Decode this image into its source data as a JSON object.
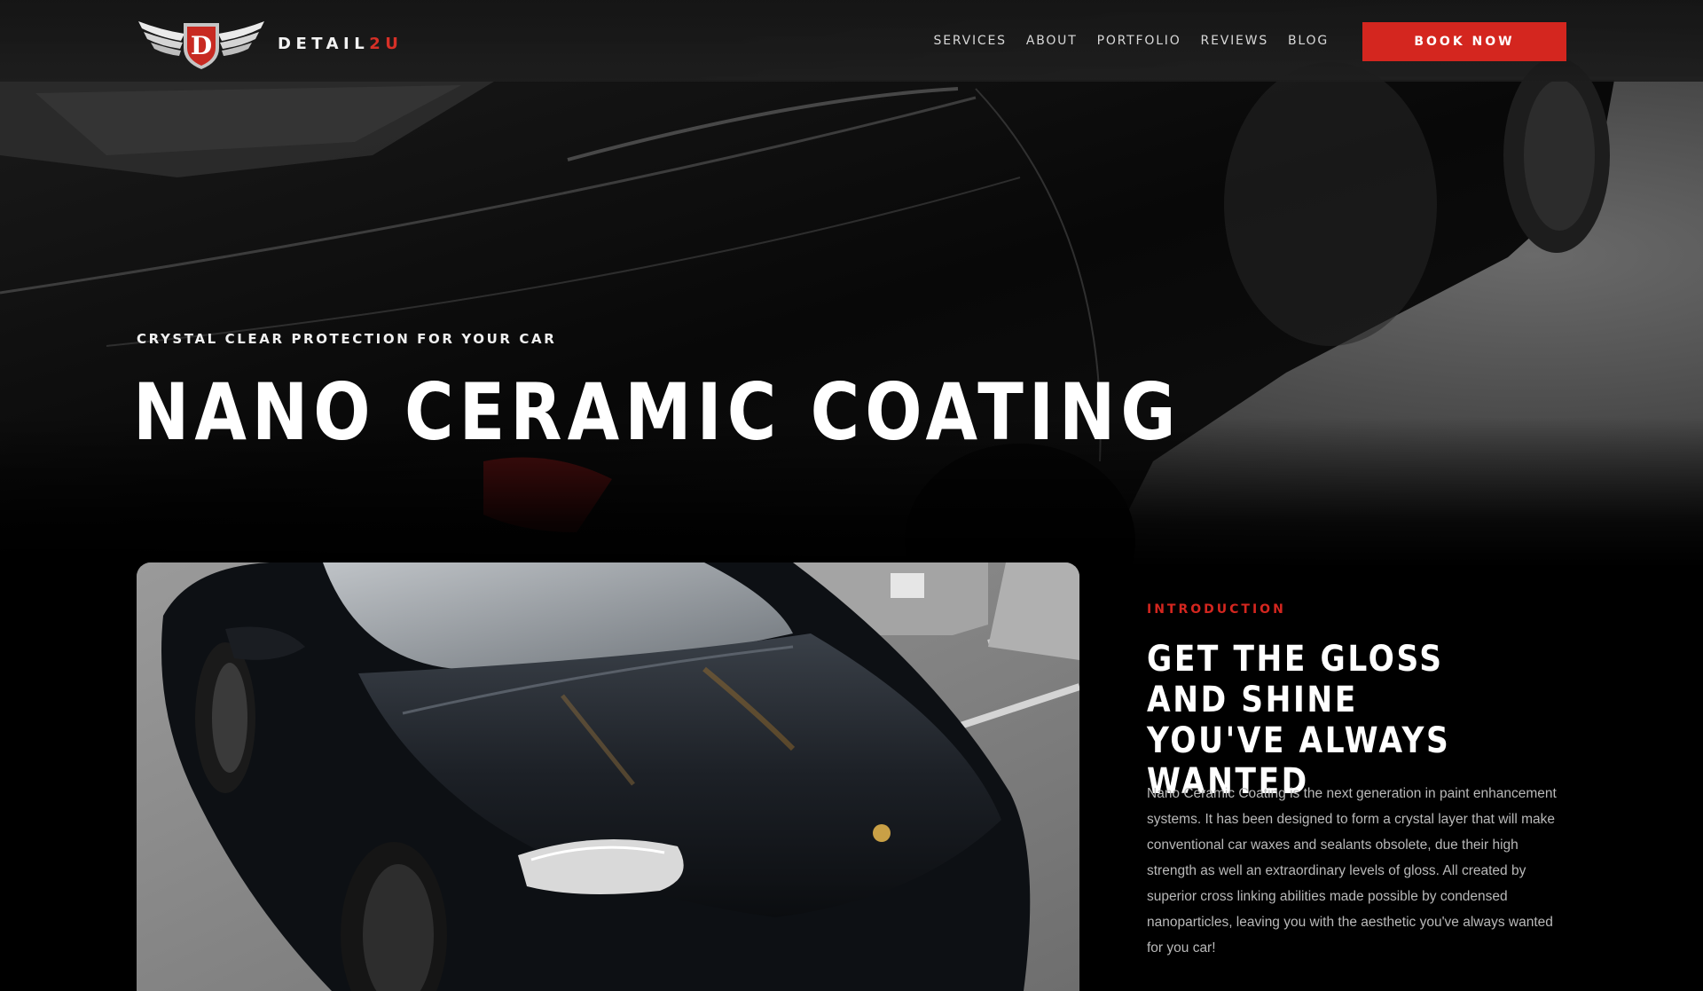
{
  "brand": {
    "logo_letter": "D",
    "name_prefix": "DETAIL",
    "name_accent": "2U",
    "accent_color": "#d4261f"
  },
  "nav": {
    "items": [
      "SERVICES",
      "ABOUT",
      "PORTFOLIO",
      "REVIEWS",
      "BLOG"
    ],
    "cta_label": "BOOK NOW"
  },
  "hero": {
    "eyebrow": "CRYSTAL CLEAR PROTECTION FOR YOUR CAR",
    "title": "NANO CERAMIC COATING"
  },
  "intro": {
    "eyebrow": "INTRODUCTION",
    "heading": "GET THE GLOSS AND SHINE YOU'VE ALWAYS WANTED",
    "body": "Nano Ceramic Coating is the next generation in paint enhancement systems. It has been designed to form a crystal layer that will make conventional car waxes and sealants obsolete, due their high strength as well an extraordinary levels of gloss. All created by superior cross linking abilities made possible by condensed nanoparticles, leaving you with the aesthetic you've always wanted for you car!"
  },
  "colors": {
    "background": "#000000",
    "cta": "#d4261f",
    "body_text": "#b9b9b9"
  }
}
